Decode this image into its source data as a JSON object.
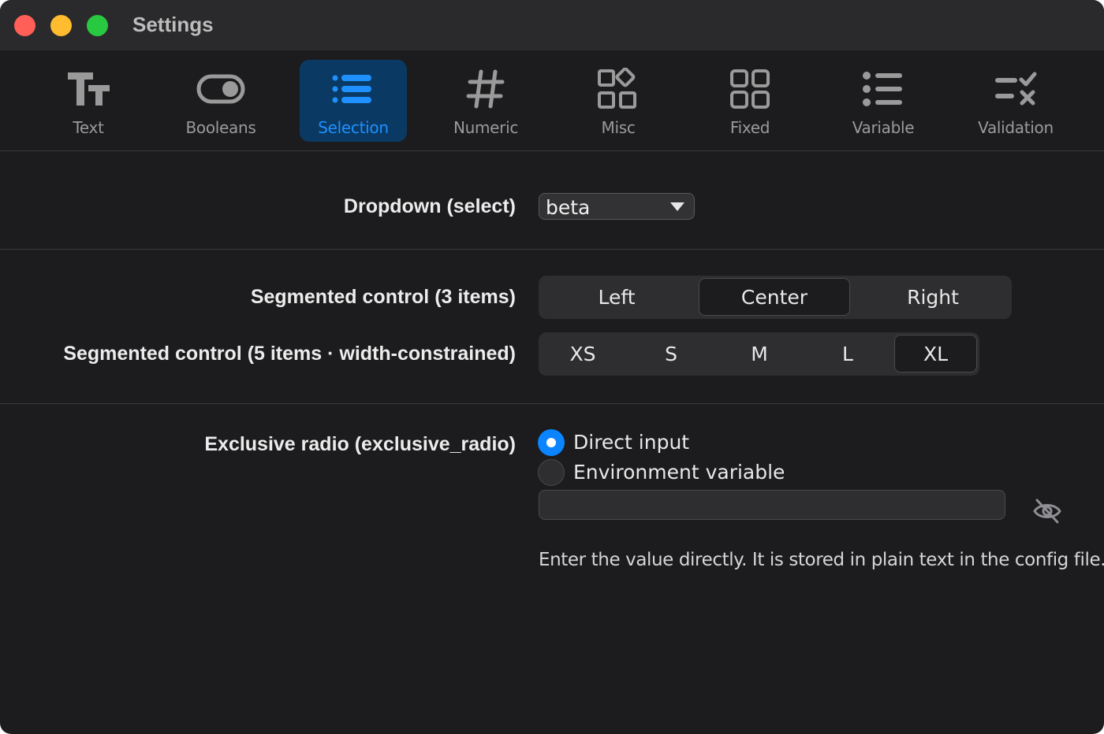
{
  "window": {
    "title": "Settings"
  },
  "toolbar": {
    "tabs": [
      {
        "label": "Text",
        "icon": "text-format-icon"
      },
      {
        "label": "Booleans",
        "icon": "toggle-icon"
      },
      {
        "label": "Selection",
        "icon": "list-icon",
        "active": true
      },
      {
        "label": "Numeric",
        "icon": "hash-icon"
      },
      {
        "label": "Misc",
        "icon": "shapes-icon"
      },
      {
        "label": "Fixed",
        "icon": "grid-icon"
      },
      {
        "label": "Variable",
        "icon": "bullet-list-icon"
      },
      {
        "label": "Validation",
        "icon": "checklist-icon"
      }
    ]
  },
  "dropdown": {
    "label": "Dropdown (select)",
    "value": "beta"
  },
  "segmented3": {
    "label": "Segmented control (3 items)",
    "options": [
      "Left",
      "Center",
      "Right"
    ],
    "selected": "Center"
  },
  "segmented5": {
    "label": "Segmented control (5 items · width-constrained)",
    "options": [
      "XS",
      "S",
      "M",
      "L",
      "XL"
    ],
    "selected": "XL"
  },
  "radio": {
    "label": "Exclusive radio (exclusive_radio)",
    "options": [
      "Direct input",
      "Environment variable"
    ],
    "selected": "Direct input",
    "input_value": "",
    "hint": "Enter the value directly. It is stored in plain text in the config file."
  },
  "colors": {
    "accent": "#0a84ff",
    "active_tab_bg": "#0a3a63",
    "window_bg": "#1c1c1e"
  }
}
